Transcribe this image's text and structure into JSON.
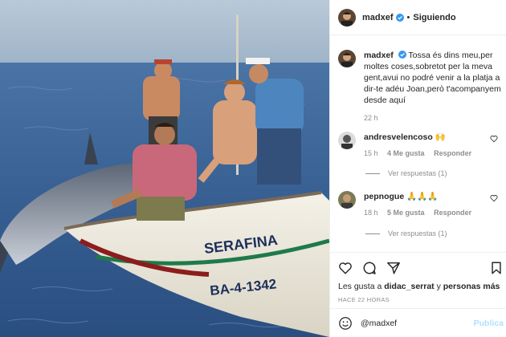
{
  "header": {
    "username": "madxef",
    "separator": "•",
    "follow_label": "Siguiendo"
  },
  "caption": {
    "username": "madxef",
    "text": "Tossa és dins meu,per moltes coses,sobretot per la meva gent,avui no podré venir a la platja a dir-te adéu Joan,però t'acompanyem desde aquí",
    "time": "22 h"
  },
  "comments": [
    {
      "username": "andresvelencoso",
      "text": "🙌",
      "time": "15 h",
      "likes": "4 Me gusta",
      "reply_label": "Responder",
      "view_replies": "Ver respuestas (1)"
    },
    {
      "username": "pepnogue",
      "text": "🙏🙏🙏",
      "time": "18 h",
      "likes": "5 Me gusta",
      "reply_label": "Responder",
      "view_replies": "Ver respuestas (1)"
    }
  ],
  "actions": {
    "likes_prefix": "Les gusta a",
    "liked_by": "didac_serrat",
    "likes_connector": "y",
    "likes_others": "personas más",
    "timestamp": "HACE 22 HORAS"
  },
  "composer": {
    "placeholder": "@madxef",
    "publish_label": "Publica"
  },
  "photo": {
    "boat_name": "SERAFINA",
    "boat_registration": "BA-4-1342"
  },
  "colors": {
    "verified": "#3897f0",
    "muted": "#8e8e8e",
    "publish_disabled": "#b2dffc",
    "sea": "#3e6a9e"
  }
}
